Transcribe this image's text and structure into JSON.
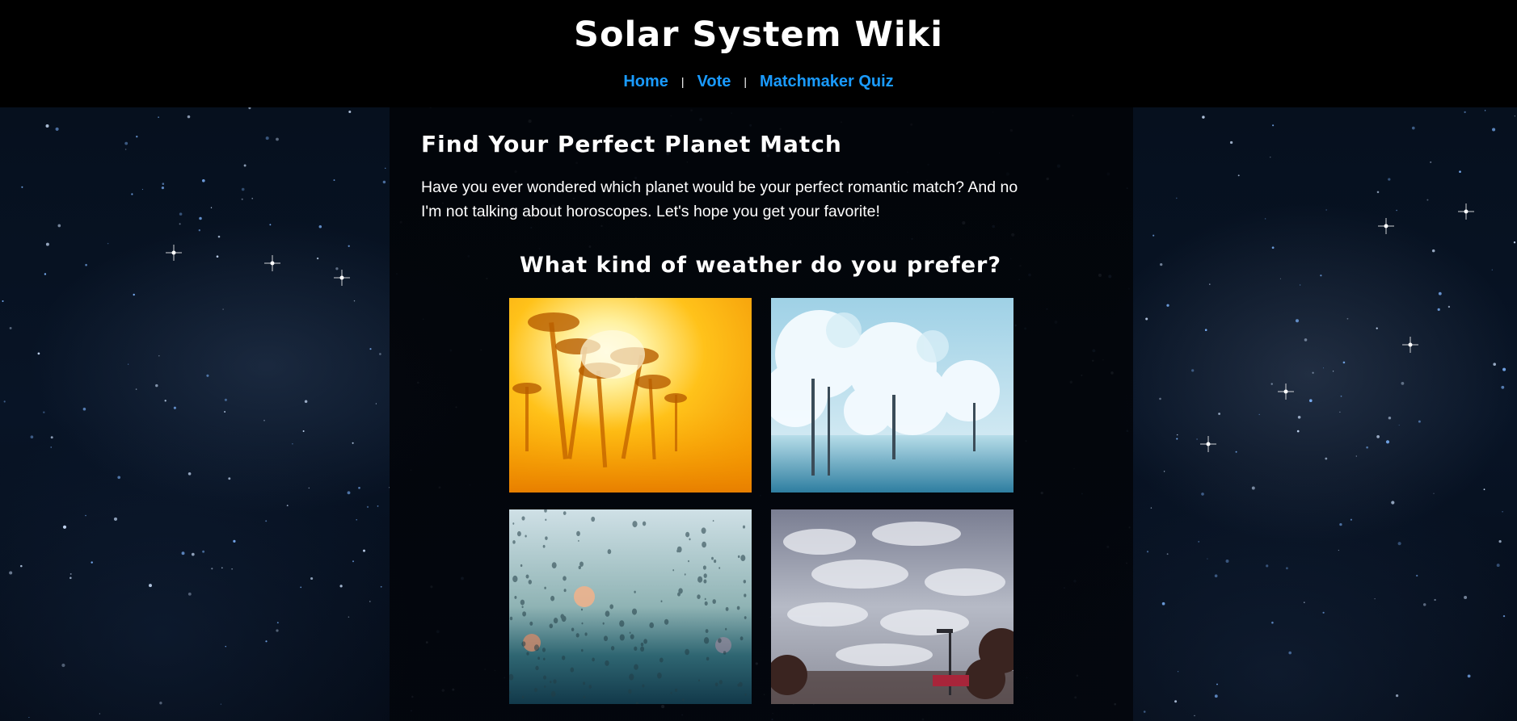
{
  "header": {
    "title": "Solar System Wiki",
    "nav": [
      {
        "label": "Home"
      },
      {
        "label": "Vote"
      },
      {
        "label": "Matchmaker Quiz"
      }
    ],
    "separator": "|",
    "link_color": "#1a9bff"
  },
  "main": {
    "heading": "Find Your Perfect Planet Match",
    "intro": "Have you ever wondered which planet would be your perfect romantic match? And no I'm not talking about horoscopes. Let's hope you get your favorite!",
    "question": "What kind of weather do you prefer?",
    "options": [
      {
        "name": "sunny-palms-image"
      },
      {
        "name": "snowy-trees-image"
      },
      {
        "name": "rainy-window-image"
      },
      {
        "name": "cloudy-sky-image"
      }
    ]
  }
}
